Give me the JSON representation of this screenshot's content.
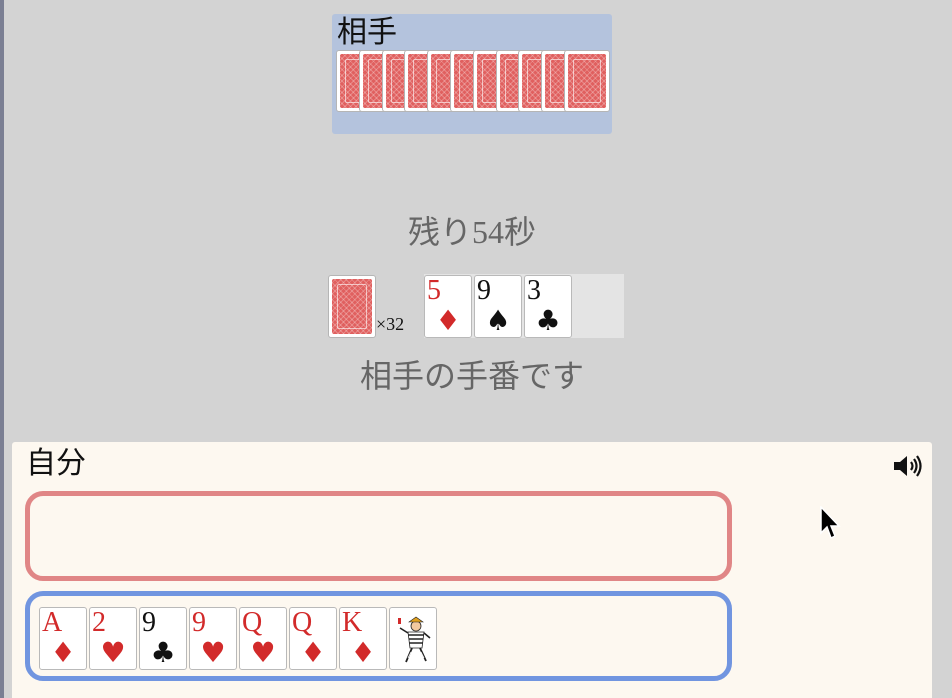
{
  "opponent": {
    "label": "相手",
    "card_count": 11
  },
  "center": {
    "timer": "残り54秒",
    "deck_count": "×32",
    "field_cards": [
      {
        "rank": "5",
        "suit": "♦",
        "color": "red"
      },
      {
        "rank": "9",
        "suit": "♠",
        "color": "black"
      },
      {
        "rank": "3",
        "suit": "♣",
        "color": "black"
      }
    ],
    "status": "相手の手番です"
  },
  "player": {
    "label": "自分",
    "hand": [
      {
        "rank": "A",
        "suit": "♦",
        "color": "red"
      },
      {
        "rank": "2",
        "suit": "♥",
        "color": "red"
      },
      {
        "rank": "9",
        "suit": "♣",
        "color": "black"
      },
      {
        "rank": "9",
        "suit": "♥",
        "color": "red"
      },
      {
        "rank": "Q",
        "suit": "♥",
        "color": "red"
      },
      {
        "rank": "Q",
        "suit": "♦",
        "color": "red"
      },
      {
        "rank": "K",
        "suit": "♦",
        "color": "red"
      },
      {
        "rank": "",
        "suit": "",
        "color": "joker",
        "icon": "joker-icon"
      }
    ],
    "sound_icon": "speaker-icon"
  },
  "colors": {
    "background": "#d3d3d3",
    "opponent_area": "#b4c3dd",
    "panel": "#fdf8f0",
    "discard_border": "#e08686",
    "hand_border": "#7195e0",
    "card_back": "#e0605f",
    "red_suit": "#d22a2a"
  }
}
